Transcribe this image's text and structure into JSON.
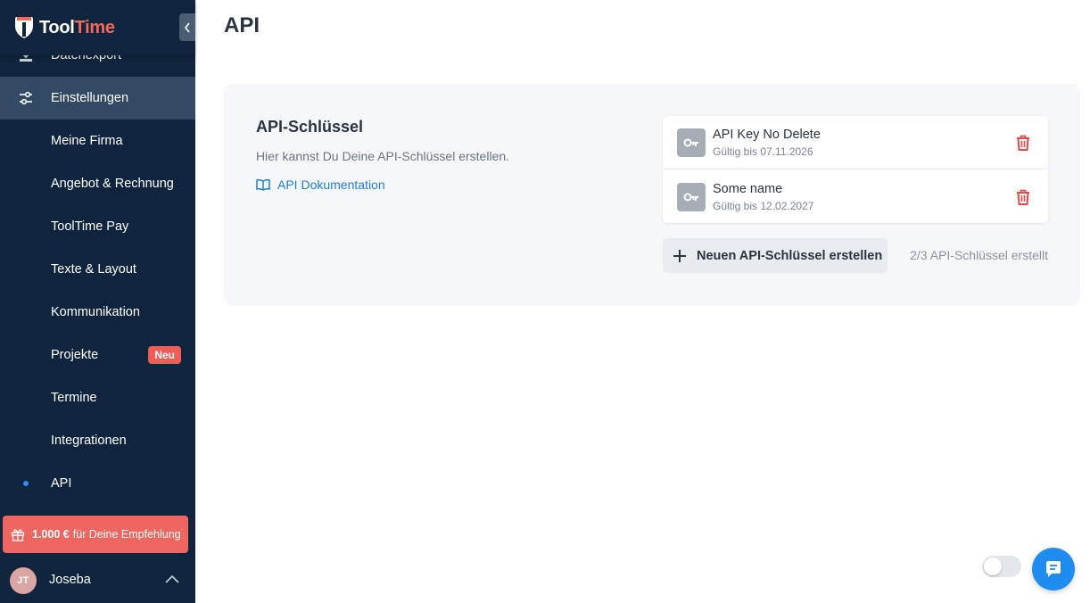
{
  "app": {
    "logo_part1": "Tool",
    "logo_part2": "Time",
    "brand_color": "#f26a5b",
    "accent_color": "#1e7fd8"
  },
  "sidebar": {
    "partial_item": {
      "label": "Datenexport",
      "icon": "download-icon"
    },
    "settings_item": {
      "label": "Einstellungen",
      "icon": "sliders-icon"
    },
    "sub_items": [
      {
        "label": "Meine Firma"
      },
      {
        "label": "Angebot & Rechnung"
      },
      {
        "label": "ToolTime Pay"
      },
      {
        "label": "Texte & Layout"
      },
      {
        "label": "Kommunikation"
      },
      {
        "label": "Projekte",
        "badge": "Neu"
      },
      {
        "label": "Termine"
      },
      {
        "label": "Integrationen"
      },
      {
        "label": "API",
        "active": true
      }
    ],
    "promo": {
      "amount": "1.000 €",
      "text": "für Deine Empfehlung",
      "icon": "gift-icon"
    },
    "user": {
      "initials": "JT",
      "name": "Joseba"
    }
  },
  "main": {
    "title": "API",
    "section": {
      "title": "API-Schlüssel",
      "description": "Hier kannst Du Deine API-Schlüssel erstellen.",
      "doc_link": "API Dokumentation"
    },
    "keys": [
      {
        "name": "API Key No Delete",
        "valid": "Gültig bis 07.11.2026"
      },
      {
        "name": "Some name",
        "valid": "Gültig bis 12.02.2027"
      }
    ],
    "new_key_button": "Neuen API-Schlüssel erstellen",
    "key_count": "2/3 API-Schlüssel erstellt"
  }
}
